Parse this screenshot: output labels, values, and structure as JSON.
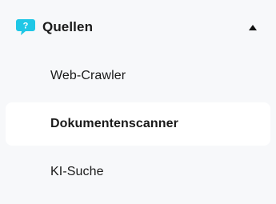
{
  "nav": {
    "section": {
      "title": "Quellen",
      "icon": "question-bubble-icon",
      "icon_color": "#1fc7e6",
      "expanded": true
    },
    "items": [
      {
        "label": "Web-Crawler",
        "active": false
      },
      {
        "label": "Dokumentenscanner",
        "active": true
      },
      {
        "label": "KI-Suche",
        "active": false
      }
    ]
  }
}
